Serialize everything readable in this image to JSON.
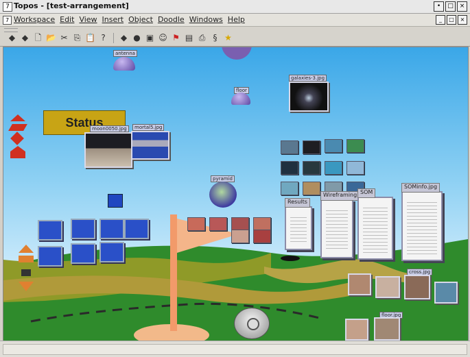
{
  "window": {
    "title": "Topos - [test-arrangement]",
    "app_icon": "7",
    "controls": [
      "•",
      "□",
      "×"
    ]
  },
  "menubar": {
    "doc_icon": "7",
    "items": [
      "Workspace",
      "Edit",
      "View",
      "Insert",
      "Object",
      "Doodle",
      "Windows",
      "Help"
    ],
    "mdi_controls": [
      "_",
      "□",
      "×"
    ]
  },
  "toolbar": {
    "icons": [
      "back-icon",
      "forward-icon",
      "new-icon",
      "open-icon",
      "cut-icon",
      "copy-icon",
      "paste-icon",
      "help-icon",
      "rotate-left-icon",
      "globe-icon",
      "box-icon",
      "person-icon",
      "flag-icon",
      "document-icon",
      "print-icon",
      "clip-icon",
      "star-icon"
    ]
  },
  "scene": {
    "status_label": "Status",
    "labels": {
      "sphere_top": "antenna",
      "sphere_small": "floor",
      "center_sphere": "pyramid",
      "galaxy": "galaxies-3.jpg",
      "moon": "moon0050.jpg",
      "mortal": "mortal5.jpg",
      "doc1": "Results",
      "doc2": "Wireframing",
      "doc3": "SOM",
      "doc4": "SOMinfo.jpg",
      "photo_a": "cross.jpg",
      "photo_b": "floor.jpg"
    },
    "colors": {
      "sky_top": "#3aa7e8",
      "sky_bottom": "#cbeafb",
      "grass": "#2f8b2c",
      "path": "#a8923a",
      "flag": "#f4b58a",
      "pole": "#f29a6a"
    }
  }
}
